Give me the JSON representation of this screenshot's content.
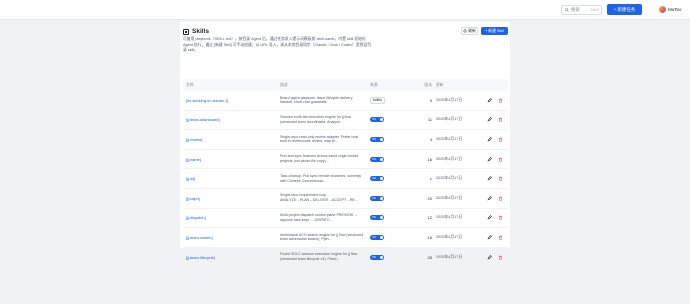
{
  "topbar": {
    "search_placeholder": "搜索",
    "search_shortcut": "Ctrl K",
    "new_task_label": "新建任务",
    "username": "MuTeo"
  },
  "page": {
    "title": "Skills",
    "description": "可复用 playbook（SKILL.md），按目录 Agent 后，通过任务发入提示词模板前 /skill-name，内置 skill 初始化 Agent 执行。通过 [新建 Skill] 可手动创建，从 URL 导入，或从本地目录同步（Claude / Grok / Codex）里预设目录 skill。",
    "refresh_label": "刷新",
    "new_skill_label": "新建 Skill"
  },
  "table": {
    "headers": [
      "名称",
      "描述",
      "来源",
      "版本",
      "更新",
      ""
    ],
    "rows": [
      {
        "name": "[im-working-on-issues-1]",
        "desc": "Board agent playbook: issue lifecycle delivery handoff, short chat guardrails",
        "source_type": "badge",
        "source": "builtin",
        "version": "9",
        "date": "2025年4月17日"
      },
      {
        "name": "[jj-team-dashboard]",
        "desc": "Session multi-tab execution engine for jj flow (versioned team coordinates, Analyze...",
        "source_type": "toggle",
        "source": "ON",
        "version": "11",
        "date": "2025年4月17日"
      },
      {
        "name": "[jj-review]",
        "desc": "Single-repo read-only review adapter. Prefer host built-in review/code review, map to...",
        "source_type": "toggle",
        "source": "ON",
        "version": "4",
        "date": "2025年4月17日"
      },
      {
        "name": "[jj-name]",
        "desc": "Port and sync features across same-origin forked projects (not whole-file copy)...",
        "source_type": "toggle",
        "source": "ON",
        "version": "16",
        "date": "2025年4月17日"
      },
      {
        "name": "[jj-wt]",
        "desc": "Task cleanup: Pull sync remote branches, currently with Chinese Conventional...",
        "source_type": "toggle",
        "source": "ON",
        "version": "1",
        "date": "2025年4月17日"
      },
      {
        "name": "[jj-ralph]",
        "desc": "Single-repo requirement loop ANALYZE→PLAN→DELIVER→ACCEPT→RE...",
        "source_type": "toggle",
        "source": "ON",
        "version": "20",
        "date": "2025年4月17日"
      },
      {
        "name": "[jj-dispatch]",
        "desc": "Multi-project dispatch control plane PREVIEW → approve task keys → DISPATC...",
        "source_type": "toggle",
        "source": "ON",
        "version": "12",
        "date": "2025年4月17日"
      },
      {
        "name": "[jj-team-swarm]",
        "desc": "Adversarial ACO search engine for jj flow (versioned team adversarial swarm), Pyth...",
        "source_type": "toggle",
        "source": "ON",
        "version": "15",
        "date": "2025年4月17日"
      },
      {
        "name": "[jj-team-lifecycle]",
        "desc": "Fused SDLC session execution engine for jj flow (versioned team lifecycle v4), Fixed...",
        "source_type": "toggle",
        "source": "ON",
        "version": "25",
        "date": "2025年4月17日"
      }
    ]
  },
  "colors": {
    "accent": "#1f63e8",
    "danger": "#e5484d"
  },
  "icons": {
    "edit": "pencil-icon",
    "delete": "trash-icon"
  }
}
